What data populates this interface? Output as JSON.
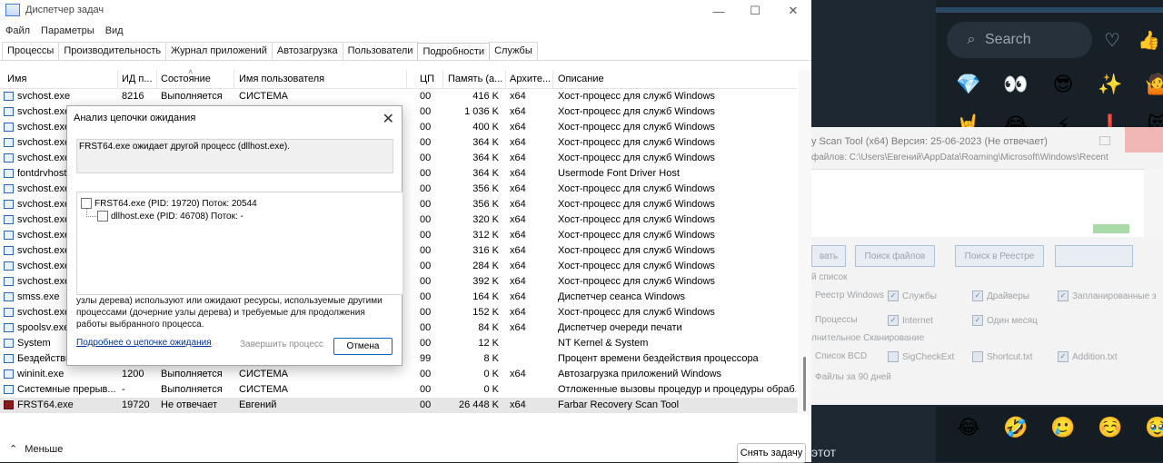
{
  "task_manager": {
    "title": "Диспетчер задач",
    "window_buttons": {
      "minimize": "—",
      "maximize": "☐",
      "close": "✕"
    },
    "menu": [
      "Файл",
      "Параметры",
      "Вид"
    ],
    "tabs": [
      "Процессы",
      "Производительность",
      "Журнал приложений",
      "Автозагрузка",
      "Пользователи",
      "Подробности",
      "Службы"
    ],
    "active_tab": "Подробности",
    "columns": [
      "Имя",
      "ИД п...",
      "Состояние",
      "Имя пользователя",
      "ЦП",
      "Память (а...",
      "Архите...",
      "Описание"
    ],
    "rows": [
      {
        "name": "svchost.exe",
        "pid": "8216",
        "state": "Выполняется",
        "user": "СИСТЕМА",
        "cpu": "00",
        "mem": "416 K",
        "arch": "x64",
        "desc": "Хост-процесс для служб Windows"
      },
      {
        "name": "svchost.exe",
        "pid": "",
        "state": "",
        "user": "",
        "cpu": "00",
        "mem": "1 036 K",
        "arch": "x64",
        "desc": "Хост-процесс для служб Windows"
      },
      {
        "name": "svchost.exe",
        "pid": "",
        "state": "",
        "user": "",
        "cpu": "00",
        "mem": "400 K",
        "arch": "x64",
        "desc": "Хост-процесс для служб Windows"
      },
      {
        "name": "svchost.exe",
        "pid": "",
        "state": "",
        "user": "",
        "cpu": "00",
        "mem": "364 K",
        "arch": "x64",
        "desc": "Хост-процесс для служб Windows"
      },
      {
        "name": "svchost.exe",
        "pid": "",
        "state": "",
        "user": "",
        "cpu": "00",
        "mem": "364 K",
        "arch": "x64",
        "desc": "Хост-процесс для служб Windows"
      },
      {
        "name": "fontdrvhost",
        "pid": "",
        "state": "",
        "user": "",
        "cpu": "00",
        "mem": "364 K",
        "arch": "x64",
        "desc": "Usermode Font Driver Host"
      },
      {
        "name": "svchost.exe",
        "pid": "",
        "state": "",
        "user": "",
        "cpu": "00",
        "mem": "356 K",
        "arch": "x64",
        "desc": "Хост-процесс для служб Windows"
      },
      {
        "name": "svchost.exe",
        "pid": "",
        "state": "",
        "user": "",
        "cpu": "00",
        "mem": "356 K",
        "arch": "x64",
        "desc": "Хост-процесс для служб Windows"
      },
      {
        "name": "svchost.exe",
        "pid": "",
        "state": "",
        "user": "",
        "cpu": "00",
        "mem": "320 K",
        "arch": "x64",
        "desc": "Хост-процесс для служб Windows"
      },
      {
        "name": "svchost.exe",
        "pid": "",
        "state": "",
        "user": "",
        "cpu": "00",
        "mem": "312 K",
        "arch": "x64",
        "desc": "Хост-процесс для служб Windows"
      },
      {
        "name": "svchost.exe",
        "pid": "",
        "state": "",
        "user": "",
        "cpu": "00",
        "mem": "316 K",
        "arch": "x64",
        "desc": "Хост-процесс для служб Windows"
      },
      {
        "name": "svchost.exe",
        "pid": "",
        "state": "",
        "user": "",
        "cpu": "00",
        "mem": "284 K",
        "arch": "x64",
        "desc": "Хост-процесс для служб Windows"
      },
      {
        "name": "svchost.exe",
        "pid": "",
        "state": "",
        "user": "",
        "cpu": "00",
        "mem": "392 K",
        "arch": "x64",
        "desc": "Хост-процесс для служб Windows"
      },
      {
        "name": "smss.exe",
        "pid": "",
        "state": "",
        "user": "",
        "cpu": "00",
        "mem": "164 K",
        "arch": "x64",
        "desc": "Диспетчер сеанса  Windows"
      },
      {
        "name": "svchost.exe",
        "pid": "",
        "state": "",
        "user": "",
        "cpu": "00",
        "mem": "152 K",
        "arch": "x64",
        "desc": "Хост-процесс для служб Windows"
      },
      {
        "name": "spoolsv.exe",
        "pid": "",
        "state": "",
        "user": "",
        "cpu": "00",
        "mem": "84 K",
        "arch": "x64",
        "desc": "Диспетчер очереди печати"
      },
      {
        "name": "System",
        "pid": "",
        "state": "",
        "user": "",
        "cpu": "00",
        "mem": "12 K",
        "arch": "",
        "desc": "NT Kernel & System"
      },
      {
        "name": "Бездействи...",
        "pid": "",
        "state": "",
        "user": "",
        "cpu": "99",
        "mem": "8 K",
        "arch": "",
        "desc": "Процент времени бездействия процессора"
      },
      {
        "name": "wininit.exe",
        "pid": "1200",
        "state": "Выполняется",
        "user": "СИСТЕМА",
        "cpu": "00",
        "mem": "0 K",
        "arch": "x64",
        "desc": "Автозагрузка приложений Windows"
      },
      {
        "name": "Системные прерыв...",
        "pid": "-",
        "state": "Выполняется",
        "user": "СИСТЕМА",
        "cpu": "00",
        "mem": "0 K",
        "arch": "",
        "desc": "Отложенные вызовы процедур и процедуры обраб..."
      },
      {
        "name": "FRST64.exe",
        "pid": "19720",
        "state": "Не отвечает",
        "user": "Евгений",
        "cpu": "00",
        "mem": "26 448 K",
        "arch": "x64",
        "desc": "Farbar Recovery Scan Tool"
      }
    ],
    "selected_row": 20,
    "less_label": "Меньше",
    "end_task_label": "Снять задачу"
  },
  "dialog": {
    "title": "Анализ цепочки ожидания",
    "message": "FRST64.exe ожидает другой процесс (dllhost.exe).",
    "tree": [
      {
        "label": "FRST64.exe (PID: 19720) Поток: 20544"
      },
      {
        "label": "dllhost.exe (PID: 46708) Поток: -"
      }
    ],
    "explanation": "узлы дерева) используют или ожидают ресурсы, используемые другими процессами (дочерние узлы дерева) и требуемые для продолжения работы выбранного процесса.",
    "link": "Подробнее о цепочке ожидания",
    "end_process_label": "Завершить процесс",
    "cancel_label": "Отмена"
  },
  "frst": {
    "title": "y Scan Tool (x64) Версия: 25-06-2023 (Не отвечает)",
    "path": "файлов: C:\\Users\\Евгений\\AppData\\Roaming\\Microsoft\\Windows\\Recent",
    "buttons": [
      "вать",
      "Поиск файлов",
      "Поиск в Реестре",
      ""
    ],
    "list_label": "й список",
    "checks_row1": [
      "Реестр Windows",
      "Службы",
      "Драйверы",
      "Запланированные з"
    ],
    "checks_row2": [
      "Процессы",
      "Internet",
      "Один месяц"
    ],
    "extra_label": "лнительное Сканирование",
    "checks_row3": [
      "Список BCD",
      "SigCheckExt",
      "Shortcut.txt",
      "Addition.txt"
    ],
    "days_label": "Файлы за 90 дней"
  },
  "emoji_app": {
    "search_placeholder": "Search",
    "row1": [
      "💎",
      "👀",
      "😎",
      "✨",
      "🤷"
    ],
    "row2": [
      "🤘",
      "😂",
      "⚡",
      "❗",
      "😻"
    ],
    "row3": [
      "😂",
      "🤣",
      "🥲",
      "☺️",
      "🥹"
    ],
    "bottom_text": "этот"
  }
}
